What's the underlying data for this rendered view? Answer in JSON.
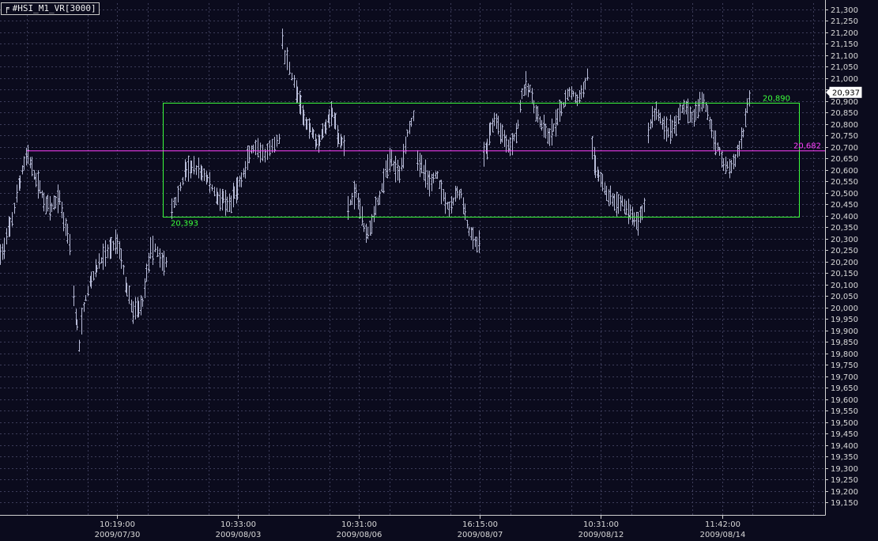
{
  "chart_title": "#HSI_M1_VR[3000]",
  "chart_data": {
    "type": "bar",
    "style": "ohlc",
    "symbol": "#HSI_M1_VR[3000]",
    "grid": true,
    "ylim": [
      19100,
      21340
    ],
    "y_ticks": [
      19150,
      19200,
      19250,
      19300,
      19350,
      19400,
      19450,
      19500,
      19550,
      19600,
      19650,
      19700,
      19750,
      19800,
      19850,
      19900,
      19950,
      20000,
      20050,
      20100,
      20150,
      20200,
      20250,
      20300,
      20350,
      20400,
      20450,
      20500,
      20550,
      20600,
      20650,
      20700,
      20750,
      20800,
      20850,
      20900,
      20950,
      21000,
      21050,
      21100,
      21150,
      21200,
      21250,
      21300
    ],
    "x_ticks": [
      {
        "time": "10:19:00",
        "date": "2009/07/30"
      },
      {
        "time": "10:33:00",
        "date": "2009/08/03"
      },
      {
        "time": "10:31:00",
        "date": "2009/08/06"
      },
      {
        "time": "16:15:00",
        "date": "2009/08/07"
      },
      {
        "time": "10:31:00",
        "date": "2009/08/12"
      },
      {
        "time": "11:42:00",
        "date": "2009/08/14"
      }
    ],
    "anchors": [
      [
        0,
        20230
      ],
      [
        5,
        20260
      ],
      [
        12,
        20350
      ],
      [
        18,
        20430
      ],
      [
        25,
        20550
      ],
      [
        30,
        20630
      ],
      [
        35,
        20670
      ],
      [
        40,
        20600
      ],
      [
        45,
        20560
      ],
      [
        50,
        20520
      ],
      [
        55,
        20470
      ],
      [
        60,
        20440
      ],
      [
        65,
        20430
      ],
      [
        70,
        20460
      ],
      [
        75,
        20480
      ],
      [
        80,
        20380
      ],
      [
        85,
        20330
      ],
      [
        90,
        20240
      ],
      [
        93,
        20050
      ],
      [
        97,
        19920
      ],
      [
        100,
        19830
      ],
      [
        103,
        19940
      ],
      [
        108,
        20040
      ],
      [
        115,
        20120
      ],
      [
        122,
        20170
      ],
      [
        130,
        20220
      ],
      [
        140,
        20260
      ],
      [
        148,
        20290
      ],
      [
        153,
        20220
      ],
      [
        160,
        20080
      ],
      [
        168,
        19980
      ],
      [
        175,
        20000
      ],
      [
        180,
        20020
      ],
      [
        185,
        20150
      ],
      [
        190,
        20240
      ],
      [
        196,
        20260
      ],
      [
        202,
        20220
      ],
      [
        207,
        20190
      ],
      [
        212,
        20200
      ],
      [
        217,
        20430
      ],
      [
        222,
        20470
      ],
      [
        228,
        20520
      ],
      [
        235,
        20600
      ],
      [
        242,
        20610
      ],
      [
        248,
        20600
      ],
      [
        255,
        20590
      ],
      [
        262,
        20560
      ],
      [
        268,
        20520
      ],
      [
        275,
        20480
      ],
      [
        282,
        20470
      ],
      [
        287,
        20440
      ],
      [
        292,
        20450
      ],
      [
        296,
        20500
      ],
      [
        300,
        20520
      ],
      [
        305,
        20560
      ],
      [
        310,
        20600
      ],
      [
        315,
        20670
      ],
      [
        320,
        20690
      ],
      [
        326,
        20680
      ],
      [
        332,
        20660
      ],
      [
        338,
        20670
      ],
      [
        344,
        20700
      ],
      [
        350,
        20720
      ],
      [
        354,
        20740
      ],
      [
        357,
        21170
      ],
      [
        360,
        21100
      ],
      [
        363,
        21080
      ],
      [
        366,
        21040
      ],
      [
        369,
        21010
      ],
      [
        372,
        20980
      ],
      [
        376,
        20930
      ],
      [
        380,
        20870
      ],
      [
        384,
        20830
      ],
      [
        388,
        20800
      ],
      [
        392,
        20780
      ],
      [
        396,
        20760
      ],
      [
        400,
        20720
      ],
      [
        404,
        20730
      ],
      [
        408,
        20760
      ],
      [
        412,
        20790
      ],
      [
        416,
        20830
      ],
      [
        420,
        20850
      ],
      [
        424,
        20800
      ],
      [
        428,
        20730
      ],
      [
        432,
        20720
      ],
      [
        436,
        20700
      ],
      [
        440,
        20440
      ],
      [
        445,
        20470
      ],
      [
        450,
        20500
      ],
      [
        455,
        20440
      ],
      [
        460,
        20350
      ],
      [
        465,
        20330
      ],
      [
        470,
        20370
      ],
      [
        475,
        20440
      ],
      [
        480,
        20480
      ],
      [
        485,
        20550
      ],
      [
        490,
        20620
      ],
      [
        495,
        20650
      ],
      [
        500,
        20600
      ],
      [
        505,
        20590
      ],
      [
        510,
        20660
      ],
      [
        515,
        20760
      ],
      [
        520,
        20810
      ],
      [
        524,
        20850
      ],
      [
        528,
        20640
      ],
      [
        533,
        20610
      ],
      [
        538,
        20580
      ],
      [
        543,
        20540
      ],
      [
        548,
        20560
      ],
      [
        553,
        20580
      ],
      [
        558,
        20510
      ],
      [
        563,
        20470
      ],
      [
        568,
        20430
      ],
      [
        573,
        20460
      ],
      [
        578,
        20500
      ],
      [
        583,
        20490
      ],
      [
        588,
        20410
      ],
      [
        593,
        20330
      ],
      [
        598,
        20300
      ],
      [
        603,
        20270
      ],
      [
        607,
        20290
      ],
      [
        612,
        20660
      ],
      [
        616,
        20700
      ],
      [
        620,
        20770
      ],
      [
        625,
        20820
      ],
      [
        630,
        20790
      ],
      [
        635,
        20760
      ],
      [
        640,
        20720
      ],
      [
        645,
        20700
      ],
      [
        650,
        20740
      ],
      [
        655,
        20800
      ],
      [
        660,
        20930
      ],
      [
        665,
        20960
      ],
      [
        670,
        20950
      ],
      [
        675,
        20880
      ],
      [
        680,
        20830
      ],
      [
        685,
        20790
      ],
      [
        690,
        20760
      ],
      [
        695,
        20740
      ],
      [
        700,
        20780
      ],
      [
        705,
        20820
      ],
      [
        710,
        20860
      ],
      [
        715,
        20900
      ],
      [
        720,
        20940
      ],
      [
        725,
        20930
      ],
      [
        730,
        20900
      ],
      [
        735,
        20930
      ],
      [
        740,
        20980
      ],
      [
        745,
        21040
      ],
      [
        749,
        20690
      ],
      [
        753,
        20620
      ],
      [
        757,
        20580
      ],
      [
        762,
        20540
      ],
      [
        767,
        20500
      ],
      [
        772,
        20480
      ],
      [
        777,
        20460
      ],
      [
        782,
        20440
      ],
      [
        787,
        20470
      ],
      [
        792,
        20430
      ],
      [
        797,
        20410
      ],
      [
        802,
        20380
      ],
      [
        807,
        20370
      ],
      [
        812,
        20420
      ],
      [
        816,
        20460
      ],
      [
        820,
        20760
      ],
      [
        825,
        20830
      ],
      [
        830,
        20860
      ],
      [
        835,
        20820
      ],
      [
        840,
        20790
      ],
      [
        845,
        20770
      ],
      [
        850,
        20780
      ],
      [
        855,
        20800
      ],
      [
        860,
        20840
      ],
      [
        865,
        20880
      ],
      [
        870,
        20860
      ],
      [
        875,
        20830
      ],
      [
        880,
        20840
      ],
      [
        885,
        20880
      ],
      [
        890,
        20910
      ],
      [
        895,
        20850
      ],
      [
        900,
        20780
      ],
      [
        905,
        20720
      ],
      [
        910,
        20680
      ],
      [
        915,
        20630
      ],
      [
        920,
        20620
      ],
      [
        925,
        20610
      ],
      [
        930,
        20640
      ],
      [
        935,
        20700
      ],
      [
        940,
        20760
      ],
      [
        945,
        20880
      ],
      [
        950,
        20930
      ]
    ],
    "levels": [
      {
        "label": "20,890",
        "value": 20890,
        "color": "#3cff3c"
      },
      {
        "label": "20,682",
        "value": 20682,
        "color": "#ff40ff"
      },
      {
        "label": "20,393",
        "value": 20393,
        "color": "#3cff3c"
      }
    ],
    "range_box": {
      "upper": 20890,
      "lower": 20393,
      "color": "#3cff3c"
    },
    "current_price": {
      "label": "20,937",
      "value": 20937
    },
    "colors": {
      "background": "#0b0b1d",
      "grid": "#3d3d5a",
      "axis": "#d0d0d0",
      "bars": "#b8bcd8"
    }
  }
}
